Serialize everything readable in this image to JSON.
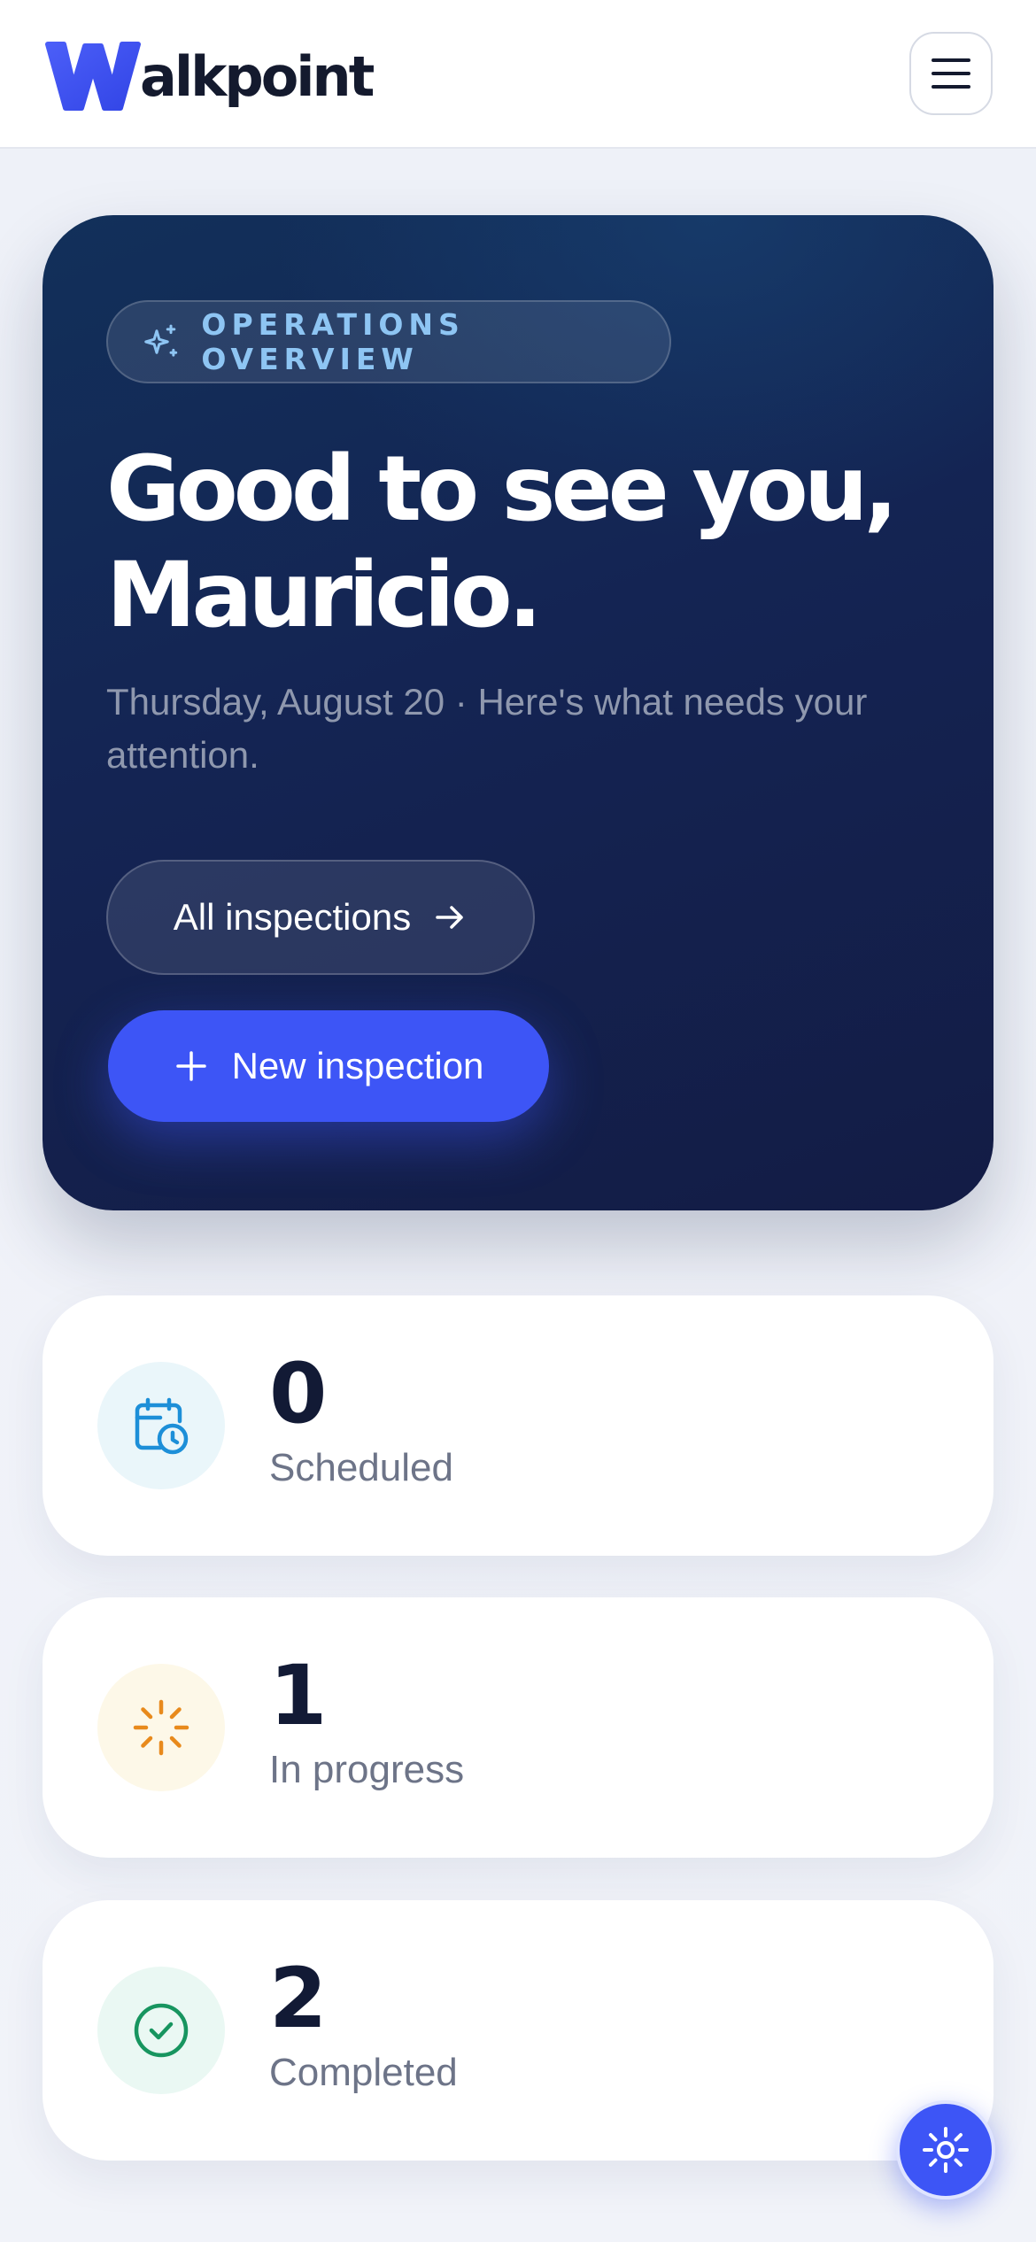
{
  "header": {
    "logo_text": "alkpoint",
    "brand_color": "#3d55f6"
  },
  "hero": {
    "badge_icon": "sparkles-icon",
    "badge_text": "OPERATIONS OVERVIEW",
    "greeting_line1": "Good to see you,",
    "greeting_line2": "Mauricio.",
    "subtitle": "Thursday, August 20 · Here's what needs your attention.",
    "all_inspections_label": "All inspections",
    "new_inspection_label": "New inspection"
  },
  "stats": [
    {
      "icon": "calendar-clock-icon",
      "value": "0",
      "label": "Scheduled",
      "color": "#1d8fd8",
      "bg": "#eaf6fa"
    },
    {
      "icon": "loader-icon",
      "value": "1",
      "label": "In progress",
      "color": "#e88a1c",
      "bg": "#fdf8e8"
    },
    {
      "icon": "check-circle-icon",
      "value": "2",
      "label": "Completed",
      "color": "#17955f",
      "bg": "#eaf8f3"
    }
  ],
  "fab": {
    "icon": "settings-icon"
  }
}
